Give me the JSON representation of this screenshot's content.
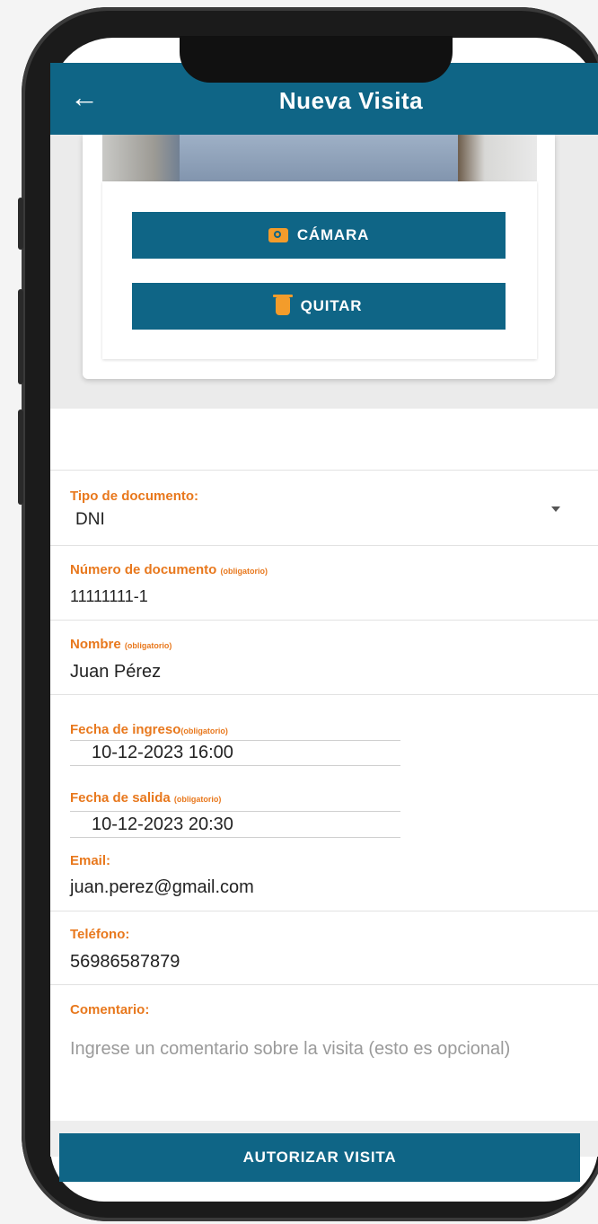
{
  "appbar": {
    "title": "Nueva Visita",
    "back_icon": "arrow-left-icon"
  },
  "photo_section": {
    "camera_label": "CÁMARA",
    "camera_icon": "camera-icon",
    "remove_label": "QUITAR",
    "remove_icon": "trash-icon"
  },
  "form": {
    "doc_type": {
      "label": "Tipo de documento:",
      "value": "DNI"
    },
    "doc_number": {
      "label": "Número de documento",
      "note": "(obligatorio)",
      "value": "11111111-1"
    },
    "name": {
      "label": "Nombre",
      "note": "(obligatorio)",
      "value": "Juan Pérez"
    },
    "entry_date": {
      "label": "Fecha de ingreso",
      "note": "(obligatorio)",
      "value": "10-12-2023 16:00"
    },
    "exit_date": {
      "label": "Fecha de salida",
      "note": "(obligatorio)",
      "value": "10-12-2023 20:30"
    },
    "email": {
      "label": "Email:",
      "value": "juan.perez@gmail.com"
    },
    "phone": {
      "label": "Teléfono:",
      "value": "56986587879"
    },
    "comment": {
      "label": "Comentario:",
      "placeholder": "Ingrese un comentario sobre la visita (esto es opcional)"
    }
  },
  "footer": {
    "authorize_label": "AUTORIZAR VISITA"
  },
  "colors": {
    "primary": "#0f6586",
    "accent": "#e8781d",
    "icon_accent": "#f39c2b"
  }
}
